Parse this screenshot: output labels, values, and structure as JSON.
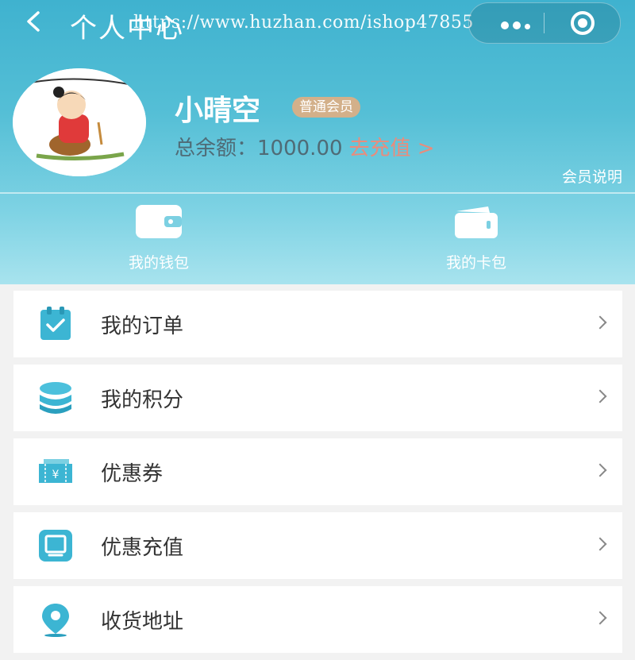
{
  "header": {
    "title": "个人中心",
    "watermark": "https://www.huzhan.com/ishop47855"
  },
  "profile": {
    "username": "小晴空",
    "member_level": "普通会员",
    "balance_label": "总余额：",
    "balance_value": "1000.00",
    "recharge_label": "去充值 >",
    "member_info_label": "会员说明"
  },
  "wallets": [
    {
      "label": "我的钱包",
      "icon": "wallet-icon"
    },
    {
      "label": "我的卡包",
      "icon": "card-pack-icon"
    }
  ],
  "menu": [
    {
      "label": "我的订单",
      "icon": "order-icon"
    },
    {
      "label": "我的积分",
      "icon": "points-icon"
    },
    {
      "label": "优惠券",
      "icon": "coupon-icon"
    },
    {
      "label": "优惠充值",
      "icon": "recharge-icon"
    },
    {
      "label": "收货地址",
      "icon": "location-icon"
    }
  ],
  "colors": {
    "header_gradient_top": "#3fb2cf",
    "header_gradient_bottom": "#a8e3ee",
    "badge": "#d3b08a",
    "recharge_text": "#e98c7c",
    "icon_accent": "#3cb5d3"
  }
}
